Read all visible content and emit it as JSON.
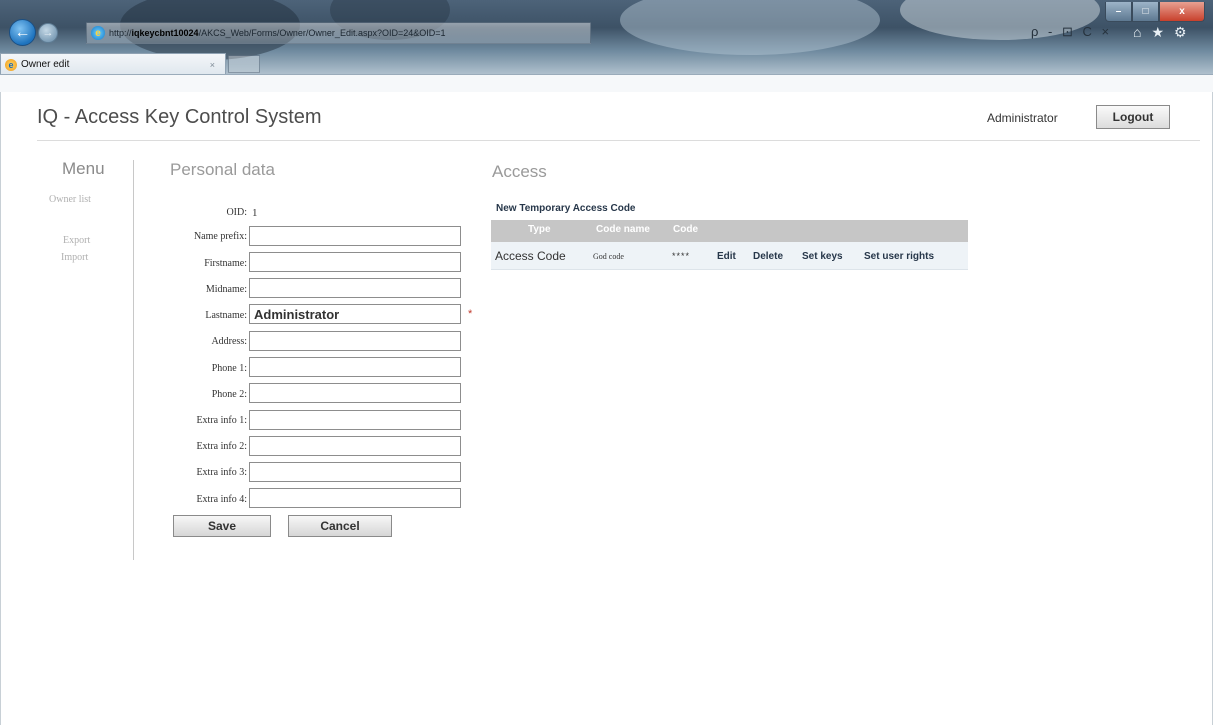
{
  "browser": {
    "url_prefix": "http://",
    "url_host": "iqkeycbnt10024",
    "url_path": "/AKCS_Web/Forms/Owner/Owner_Edit.aspx?OID=24&OID=1",
    "tab_title": "Owner edit",
    "tab_close": "×",
    "addr_tools": "ρ - ⊡ C ×",
    "icons": [
      "back-icon",
      "forward-icon",
      "home-icon",
      "favorites-icon",
      "settings-icon"
    ]
  },
  "window": {
    "minimize": "–",
    "maximize": "□",
    "close": "x"
  },
  "header": {
    "app_title": "IQ - Access Key Control System",
    "user": "Administrator",
    "logout_label": "Logout"
  },
  "menu": {
    "title": "Menu",
    "items": [
      {
        "label": "Owner list"
      },
      {
        "label": "Export"
      },
      {
        "label": "Import"
      }
    ]
  },
  "personal": {
    "title": "Personal data",
    "oid_label": "OID:",
    "oid_value": "1",
    "fields": [
      {
        "label": "Name prefix:",
        "value": ""
      },
      {
        "label": "Firstname:",
        "value": ""
      },
      {
        "label": "Midname:",
        "value": ""
      },
      {
        "label": "Lastname:",
        "value": "Administrator"
      },
      {
        "label": "Address:",
        "value": ""
      },
      {
        "label": "Phone 1:",
        "value": ""
      },
      {
        "label": "Phone 2:",
        "value": ""
      },
      {
        "label": "Extra info 1:",
        "value": ""
      },
      {
        "label": "Extra info 2:",
        "value": ""
      },
      {
        "label": "Extra info 3:",
        "value": ""
      },
      {
        "label": "Extra info 4:",
        "value": ""
      }
    ],
    "required_marker": "*",
    "save_label": "Save",
    "cancel_label": "Cancel"
  },
  "access": {
    "title": "Access",
    "new_temp_label": "New Temporary Access Code",
    "columns": [
      "Type",
      "Code name",
      "Code"
    ],
    "rows": [
      {
        "type": "Access Code",
        "code_name": "God code",
        "code": "****",
        "edit": "Edit",
        "delete": "Delete",
        "set_keys": "Set keys",
        "set_rights": "Set user rights"
      }
    ]
  }
}
